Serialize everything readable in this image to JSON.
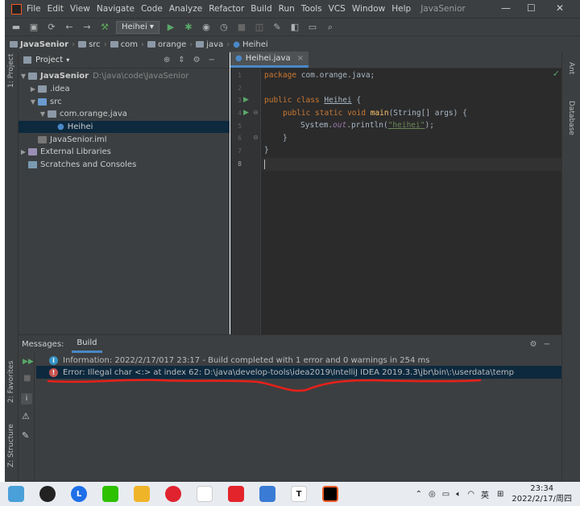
{
  "menu": {
    "items": [
      "File",
      "Edit",
      "View",
      "Navigate",
      "Code",
      "Analyze",
      "Refactor",
      "Build",
      "Run",
      "Tools",
      "VCS",
      "Window",
      "Help"
    ],
    "project_name": "JavaSenior"
  },
  "toolbar": {
    "run_config": "Heihei"
  },
  "breadcrumbs": [
    "JavaSenior",
    "src",
    "com",
    "orange",
    "java",
    "Heihei"
  ],
  "left_stripe": {
    "project_label": "1: Project",
    "favorites_label": "2: Favorites",
    "structure_label": "Z: Structure"
  },
  "right_stripe": {
    "ant_label": "Ant",
    "database_label": "Database"
  },
  "project_panel": {
    "title": "Project",
    "tree": [
      {
        "label": "JavaSenior",
        "path": "D:\\java\\code\\JavaSenior"
      },
      {
        "label": ".idea"
      },
      {
        "label": "src"
      },
      {
        "label": "com.orange.java"
      },
      {
        "label": "Heihei"
      },
      {
        "label": "JavaSenior.iml"
      },
      {
        "label": "External Libraries"
      },
      {
        "label": "Scratches and Consoles"
      }
    ]
  },
  "editor": {
    "tab": "Heihei.java",
    "line_numbers": [
      "1",
      "2",
      "3",
      "4",
      "5",
      "6",
      "7",
      "8"
    ],
    "lines": {
      "l1_kw": "package",
      "l1_rest": " com.orange.java;",
      "l3_kw": "public class",
      "l3_cls": "Heihei",
      "l3_rest": " {",
      "l4_kw": "public static void",
      "l4_fn": "main",
      "l4_rest": "(String[] args) {",
      "l5_a": "System.",
      "l5_out": "out",
      "l5_b": ".println(",
      "l5_str": "\"heihei\"",
      "l5_c": ");",
      "l6": "}",
      "l7": "}"
    }
  },
  "messages": {
    "label": "Messages:",
    "tab": "Build",
    "info": "Information: 2022/2/17/017 23:17 - Build completed with 1 error and 0 warnings in 254 ms",
    "error": "Error: Illegal char <:> at index 62: D:\\java\\develop-tools\\idea2019\\IntelliJ IDEA 2019.3.3\\jbr\\bin\\:\\userdata\\temp"
  },
  "taskbar": {
    "ime": "英",
    "time": "23:34",
    "date": "2022/2/17/周四"
  },
  "colors": {
    "annotation": "#e8201a",
    "selection": "#0d293e",
    "accent": "#4a88c7"
  }
}
